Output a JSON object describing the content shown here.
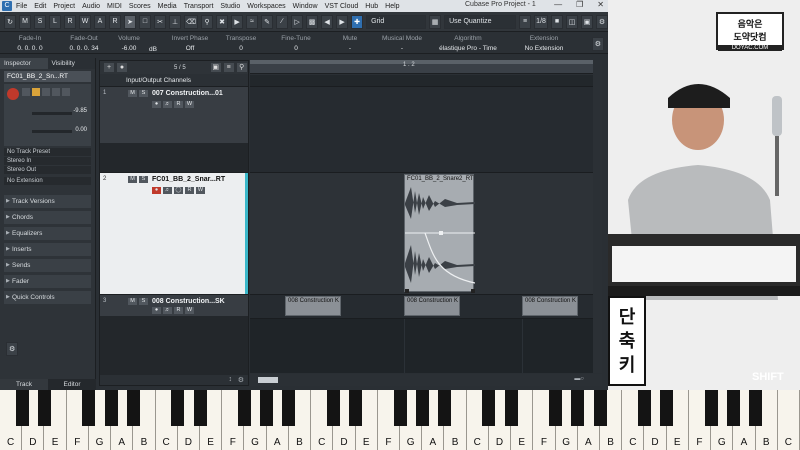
{
  "app": {
    "window_title": "Cubase Pro Project - 1",
    "menu": [
      "File",
      "Edit",
      "Project",
      "Audio",
      "MIDI",
      "Scores",
      "Media",
      "Transport",
      "Studio",
      "Workspaces",
      "Window",
      "VST Cloud",
      "Hub",
      "Help"
    ]
  },
  "toolbar": {
    "buttons": [
      "M",
      "S",
      "L",
      "R",
      "W",
      "A",
      "R"
    ],
    "grid_value": "Grid",
    "quantize_value": "Use Quantize",
    "quantize_amount": "1/8"
  },
  "infoline": [
    {
      "label": "Fade-In",
      "value": "0. 0. 0. 0"
    },
    {
      "label": "Fade-Out",
      "value": "0. 0. 0. 34"
    },
    {
      "label": "Volume",
      "value": "-6.00"
    },
    {
      "label": "dB",
      "value": ""
    },
    {
      "label": "Invert Phase",
      "value": "Off"
    },
    {
      "label": "Transpose",
      "value": "0"
    },
    {
      "label": "Fine-Tune",
      "value": "0"
    },
    {
      "label": "Mute",
      "value": "-"
    },
    {
      "label": "Musical Mode",
      "value": "-"
    },
    {
      "label": "Algorithm",
      "value": "élastique Pro - Time"
    },
    {
      "label": "Extension",
      "value": "No Extension"
    }
  ],
  "inspector": {
    "tabs": [
      "Inspector",
      "Visibility"
    ],
    "track_name": "FC01_BB_2_Sn...RT",
    "volume": "-9.85",
    "pan": "0.00",
    "rows": [
      "No Track Preset",
      "Stereo In",
      "Stereo Out",
      "No Extension"
    ],
    "sections": [
      "Track Versions",
      "Chords",
      "Equalizers",
      "Inserts",
      "Sends",
      "Fader",
      "Quick Controls"
    ],
    "bottom_tabs": [
      "Track",
      "Editor"
    ]
  },
  "tracklist": {
    "counter": "5 / 5",
    "folder_name": "Input/Output Channels",
    "tracks": [
      {
        "num": "1",
        "name": "007 Construction...01"
      },
      {
        "num": "2",
        "name": "FC01_BB_2_Snar...RT"
      },
      {
        "num": "3",
        "name": "008 Construction...SK"
      }
    ]
  },
  "ruler": {
    "marker": "1 . 2"
  },
  "events": {
    "big_event_name": "FC01_BB_2_Snare2_RT",
    "construction_name": "008 Construction K"
  },
  "video": {
    "logo_line1": "음악은",
    "logo_line2": "도약닷컴",
    "logo_line3": "DOYAC.COM",
    "caption_chars": [
      "단",
      "축",
      "키"
    ],
    "shift_label": "SHIFT"
  },
  "keyboard": {
    "notes": [
      "C",
      "D",
      "E",
      "F",
      "G",
      "A",
      "B",
      "C",
      "D",
      "E",
      "F",
      "G",
      "A",
      "B",
      "C",
      "D",
      "E",
      "F",
      "G",
      "A",
      "B",
      "C",
      "D",
      "E",
      "F",
      "G",
      "A",
      "B",
      "C",
      "D",
      "E",
      "F",
      "G",
      "A",
      "B",
      "C"
    ]
  }
}
